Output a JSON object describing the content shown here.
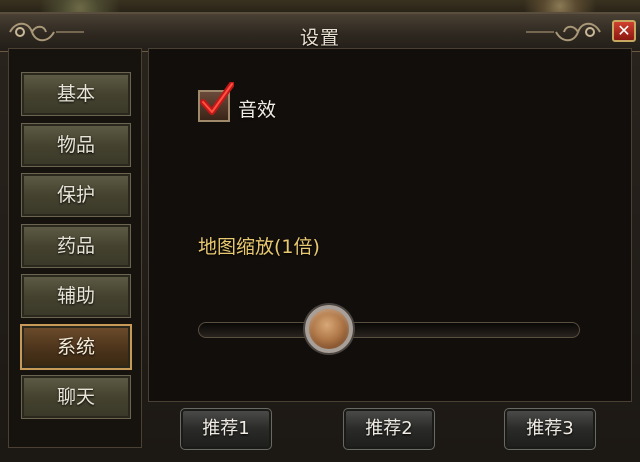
{
  "window": {
    "title": "设置"
  },
  "sidebar": {
    "tabs": [
      {
        "label": "基本",
        "active": false
      },
      {
        "label": "物品",
        "active": false
      },
      {
        "label": "保护",
        "active": false
      },
      {
        "label": "药品",
        "active": false
      },
      {
        "label": "辅助",
        "active": false
      },
      {
        "label": "系统",
        "active": true
      },
      {
        "label": "聊天",
        "active": false
      }
    ]
  },
  "settings": {
    "sound": {
      "label": "音效",
      "checked": true
    },
    "map_zoom": {
      "label": "地图缩放(1倍)",
      "slider_fraction": 0.32
    }
  },
  "footer": {
    "buttons": [
      {
        "label": "推荐1"
      },
      {
        "label": "推荐2"
      },
      {
        "label": "推荐3"
      }
    ]
  },
  "colors": {
    "accent_gold": "#e8c870",
    "active_tab_border": "#c89a58",
    "check_red": "#c01818"
  },
  "icons": {
    "close": "close-icon",
    "check": "check-icon"
  }
}
